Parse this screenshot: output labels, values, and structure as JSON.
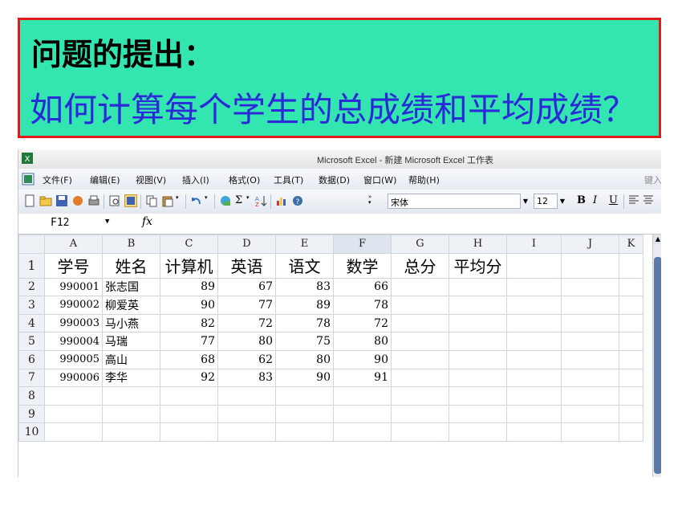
{
  "slide": {
    "title_line1": "问题的提出：",
    "title_line2": "如何计算每个学生的总成绩和平均成绩？",
    "box_bg": "#33e6b0",
    "box_border": "#e01b1b",
    "question_color": "#2a2ad8"
  },
  "excel": {
    "window_title": "Microsoft Excel - 新建 Microsoft Excel 工作表",
    "menu": [
      {
        "label": "文件(F)"
      },
      {
        "label": "编辑(E)"
      },
      {
        "label": "视图(V)"
      },
      {
        "label": "插入(I)"
      },
      {
        "label": "格式(O)"
      },
      {
        "label": "工具(T)"
      },
      {
        "label": "数据(D)"
      },
      {
        "label": "窗口(W)"
      },
      {
        "label": "帮助(H)"
      }
    ],
    "help_box_text": "键入",
    "font_name": "宋体",
    "font_size": "12",
    "format_buttons": [
      "B",
      "I",
      "U"
    ],
    "name_box": "F12",
    "fx_label": "fx",
    "columns": [
      "A",
      "B",
      "C",
      "D",
      "E",
      "F",
      "G",
      "H",
      "I",
      "J",
      "K"
    ],
    "header_row": [
      "学号",
      "姓名",
      "计算机",
      "英语",
      "语文",
      "数学",
      "总分",
      "平均分",
      "",
      "",
      ""
    ],
    "rows": [
      {
        "num": "2",
        "id": "990001",
        "name": "张志国",
        "computer": "89",
        "english": "67",
        "chinese": "83",
        "math": "66"
      },
      {
        "num": "3",
        "id": "990002",
        "name": "柳爱英",
        "computer": "90",
        "english": "77",
        "chinese": "89",
        "math": "78"
      },
      {
        "num": "4",
        "id": "990003",
        "name": "马小燕",
        "computer": "82",
        "english": "72",
        "chinese": "78",
        "math": "72"
      },
      {
        "num": "5",
        "id": "990004",
        "name": "马瑞",
        "computer": "77",
        "english": "80",
        "chinese": "75",
        "math": "80"
      },
      {
        "num": "6",
        "id": "990005",
        "name": "高山",
        "computer": "68",
        "english": "62",
        "chinese": "80",
        "math": "90"
      },
      {
        "num": "7",
        "id": "990006",
        "name": "李华",
        "computer": "92",
        "english": "83",
        "chinese": "90",
        "math": "91"
      }
    ],
    "empty_rows": [
      "8",
      "9",
      "10"
    ]
  }
}
